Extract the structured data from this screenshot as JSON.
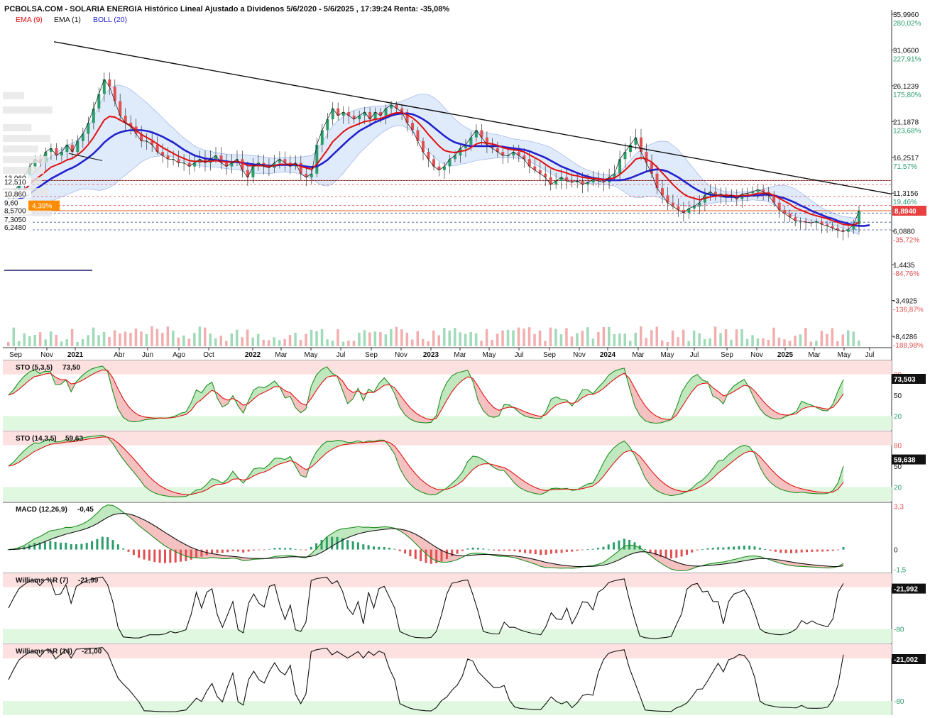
{
  "header": {
    "title": "PCBOLSA.COM - SOLARIA ENERGIA Histórico Lineal Ajustado a Dividenos 5/6/2020 - 5/6/2025 , 17:39:24 Renta: -35,08%",
    "legend": [
      {
        "label": "EMA (9)",
        "color": "#e01010"
      },
      {
        "label": "EMA (1)",
        "color": "#111111"
      },
      {
        "label": "BOLL (20)",
        "color": "#2222cc"
      }
    ]
  },
  "chart_data": [
    {
      "type": "line",
      "panel": "price",
      "ylim": [
        -8.43,
        35.996
      ],
      "right_axis": [
        {
          "value": 35.996,
          "label": "35,9960",
          "pct": "280,02%"
        },
        {
          "value": 31.06,
          "label": "31,0600",
          "pct": "227,91%"
        },
        {
          "value": 26.1239,
          "label": "26,1239",
          "pct": "175,80%"
        },
        {
          "value": 21.1878,
          "label": "21,1878",
          "pct": "123,68%"
        },
        {
          "value": 16.2517,
          "label": "16,2517",
          "pct": "71,57%"
        },
        {
          "value": 11.3156,
          "label": "11,3156",
          "pct": "19,46%"
        },
        {
          "value": 6.088,
          "label": "6,0880",
          "pct": "-35,72%"
        },
        {
          "value": 1.4435,
          "label": "1,4435",
          "pct": "-84,76%"
        },
        {
          "value": -3.4925,
          "label": "-3,4925",
          "pct": "-136,87%"
        },
        {
          "value": -8.4286,
          "label": "-8,4286",
          "pct": "-188,98%"
        }
      ],
      "last_price": {
        "value": 8.894,
        "label": "8,8940"
      },
      "left_levels": [
        {
          "value": 13.06,
          "label": "13,060"
        },
        {
          "value": 12.51,
          "label": "12,510"
        },
        {
          "value": 10.86,
          "label": "10,860"
        },
        {
          "value": 9.6,
          "label": "9,60"
        },
        {
          "value": 8.57,
          "label": "8,5700"
        },
        {
          "value": 7.305,
          "label": "7,3050"
        },
        {
          "value": 6.248,
          "label": "6,2480"
        }
      ],
      "pct_badge": "4,39%",
      "x_labels": [
        "Sep",
        "Nov",
        "2021",
        "Abr",
        "Jun",
        "Ago",
        "Oct",
        "2022",
        "Mar",
        "May",
        "Jul",
        "Sep",
        "Nov",
        "2023",
        "Mar",
        "May",
        "Jul",
        "Sep",
        "Nov",
        "2024",
        "Mar",
        "May",
        "Jul",
        "Sep",
        "Nov",
        "2025",
        "Mar",
        "May",
        "Jul"
      ],
      "price": [
        11.0,
        11.5,
        12.5,
        13.5,
        15.0,
        16.0,
        15.5,
        17.0,
        17.5,
        16.5,
        17.0,
        18.0,
        17.0,
        18.5,
        19.5,
        21.0,
        23.0,
        25.0,
        27.0,
        26.0,
        24.0,
        22.0,
        21.0,
        20.5,
        19.5,
        18.5,
        18.5,
        18.0,
        17.0,
        16.5,
        16.0,
        16.0,
        15.5,
        15.5,
        15.0,
        15.5,
        16.0,
        15.5,
        16.0,
        16.5,
        15.5,
        15.0,
        15.5,
        16.0,
        14.5,
        13.5,
        15.0,
        15.5,
        15.0,
        14.8,
        15.5,
        16.0,
        15.5,
        15.0,
        15.5,
        14.0,
        13.5,
        14.0,
        18.0,
        20.0,
        21.5,
        23.0,
        22.0,
        22.5,
        22.0,
        21.5,
        22.0,
        22.5,
        21.5,
        22.5,
        22.0,
        23.0,
        23.5,
        23.0,
        22.5,
        21.0,
        20.0,
        18.5,
        17.0,
        16.0,
        15.0,
        14.5,
        15.0,
        16.0,
        16.5,
        17.5,
        18.0,
        19.0,
        20.0,
        19.0,
        18.0,
        17.5,
        17.0,
        16.5,
        16.5,
        17.0,
        16.5,
        16.0,
        15.0,
        14.5,
        14.0,
        13.5,
        12.5,
        13.0,
        13.5,
        13.0,
        12.8,
        13.0,
        12.5,
        12.8,
        13.2,
        13.0,
        12.8,
        13.5,
        14.0,
        16.0,
        17.0,
        18.0,
        19.0,
        17.0,
        15.5,
        14.0,
        12.0,
        11.0,
        10.0,
        9.5,
        9.0,
        8.6,
        9.2,
        9.5,
        10.0,
        11.0,
        11.5,
        11.0,
        11.2,
        10.8,
        11.0,
        10.5,
        11.2,
        11.3,
        11.5,
        11.8,
        11.5,
        11.0,
        10.0,
        9.0,
        8.5,
        8.0,
        7.5,
        7.5,
        7.3,
        7.2,
        7.4,
        7.0,
        6.8,
        6.5,
        6.2,
        6.0,
        6.3,
        7.0,
        8.894
      ],
      "ema9": [
        11.0,
        11.1,
        11.4,
        11.8,
        12.5,
        13.2,
        13.7,
        14.3,
        14.9,
        15.2,
        15.5,
        15.9,
        16.1,
        16.6,
        17.2,
        18.0,
        19.0,
        20.2,
        21.4,
        21.9,
        21.8,
        21.4,
        21.0,
        20.6,
        20.0,
        19.4,
        19.0,
        18.6,
        18.1,
        17.6,
        17.2,
        16.8,
        16.4,
        16.1,
        15.8,
        15.7,
        15.7,
        15.7,
        15.7,
        15.8,
        15.7,
        15.6,
        15.6,
        15.7,
        15.5,
        15.1,
        15.1,
        15.1,
        15.1,
        15.0,
        15.1,
        15.3,
        15.3,
        15.3,
        15.3,
        15.0,
        14.8,
        14.6,
        15.3,
        16.3,
        17.3,
        18.4,
        19.1,
        19.8,
        20.3,
        20.6,
        20.9,
        21.2,
        21.3,
        21.5,
        21.6,
        21.9,
        22.2,
        22.4,
        22.4,
        22.1,
        21.7,
        21.1,
        20.3,
        19.4,
        18.6,
        17.8,
        17.2,
        17.0,
        16.9,
        17.1,
        17.2,
        17.6,
        18.1,
        18.3,
        18.2,
        18.1,
        17.9,
        17.6,
        17.4,
        17.3,
        17.2,
        17.0,
        16.6,
        16.2,
        15.8,
        15.3,
        14.8,
        14.5,
        14.3,
        14.1,
        13.8,
        13.7,
        13.5,
        13.4,
        13.3,
        13.3,
        13.2,
        13.3,
        13.4,
        13.9,
        14.5,
        15.2,
        16.0,
        16.2,
        16.0,
        15.6,
        14.9,
        14.1,
        13.3,
        12.5,
        11.8,
        11.2,
        10.8,
        10.6,
        10.4,
        10.6,
        10.8,
        10.9,
        11.0,
        11.0,
        11.0,
        10.9,
        11.0,
        11.0,
        11.1,
        11.3,
        11.3,
        11.3,
        11.0,
        10.6,
        10.2,
        9.8,
        9.3,
        9.0,
        8.7,
        8.4,
        8.2,
        8.0,
        7.8,
        7.5,
        7.3,
        7.0,
        6.9,
        6.9,
        7.3
      ],
      "boll_mid": [
        10.0,
        10.2,
        10.5,
        10.8,
        11.2,
        11.8,
        12.3,
        12.8,
        13.3,
        13.7,
        14.1,
        14.5,
        14.8,
        15.2,
        15.7,
        16.2,
        16.8,
        17.5,
        18.3,
        18.9,
        19.4,
        19.7,
        19.9,
        20.0,
        20.0,
        20.0,
        19.9,
        19.7,
        19.4,
        19.1,
        18.7,
        18.3,
        17.8,
        17.3,
        16.9,
        16.5,
        16.3,
        16.1,
        16.0,
        15.9,
        15.8,
        15.7,
        15.6,
        15.6,
        15.5,
        15.4,
        15.3,
        15.2,
        15.2,
        15.1,
        15.1,
        15.2,
        15.2,
        15.2,
        15.2,
        15.1,
        15.0,
        14.9,
        15.0,
        15.4,
        15.9,
        16.6,
        17.3,
        18.0,
        18.7,
        19.3,
        19.9,
        20.3,
        20.7,
        21.1,
        21.4,
        21.7,
        22.0,
        22.2,
        22.3,
        22.3,
        22.2,
        21.9,
        21.5,
        21.0,
        20.4,
        19.8,
        19.2,
        18.7,
        18.3,
        18.1,
        17.9,
        17.8,
        17.8,
        17.8,
        17.8,
        17.8,
        17.8,
        17.7,
        17.6,
        17.5,
        17.4,
        17.3,
        17.1,
        16.8,
        16.5,
        16.2,
        15.8,
        15.4,
        15.0,
        14.7,
        14.4,
        14.1,
        13.8,
        13.6,
        13.4,
        13.3,
        13.2,
        13.1,
        13.1,
        13.1,
        13.2,
        13.4,
        13.7,
        14.0,
        14.3,
        14.5,
        14.6,
        14.5,
        14.3,
        13.9,
        13.5,
        13.0,
        12.5,
        12.0,
        11.6,
        11.3,
        11.1,
        11.0,
        10.9,
        10.8,
        10.8,
        10.8,
        10.9,
        10.9,
        11.0,
        11.0,
        11.1,
        11.1,
        11.0,
        10.8,
        10.6,
        10.3,
        10.0,
        9.6,
        9.3,
        8.9,
        8.6,
        8.3,
        8.0,
        7.8,
        7.5,
        7.3,
        7.1,
        6.9,
        6.8,
        6.8,
        6.9
      ],
      "boll_width": [
        1.5,
        1.6,
        1.8,
        2.0,
        2.3,
        2.6,
        2.8,
        3.0,
        3.1,
        3.2,
        3.3,
        3.4,
        3.4,
        3.5,
        3.8,
        4.3,
        5.0,
        5.8,
        6.5,
        6.8,
        6.8,
        6.5,
        6.1,
        5.6,
        5.0,
        4.4,
        3.9,
        3.4,
        3.0,
        2.6,
        2.2,
        2.0,
        1.8,
        1.6,
        1.5,
        1.3,
        1.2,
        1.1,
        1.1,
        1.0,
        1.0,
        1.0,
        1.0,
        1.0,
        1.1,
        1.2,
        1.2,
        1.2,
        1.1,
        1.1,
        1.0,
        1.0,
        1.0,
        1.0,
        1.1,
        1.2,
        1.4,
        1.6,
        2.2,
        3.0,
        3.6,
        4.0,
        4.0,
        3.9,
        3.7,
        3.4,
        3.1,
        2.8,
        2.5,
        2.2,
        1.9,
        1.7,
        1.6,
        1.6,
        1.7,
        2.0,
        2.4,
        3.0,
        3.5,
        3.9,
        4.1,
        4.1,
        3.9,
        3.6,
        3.2,
        2.8,
        2.5,
        2.2,
        2.0,
        1.9,
        1.8,
        1.7,
        1.6,
        1.5,
        1.4,
        1.3,
        1.3,
        1.3,
        1.4,
        1.5,
        1.6,
        1.7,
        1.8,
        1.8,
        1.7,
        1.5,
        1.3,
        1.1,
        1.0,
        0.9,
        0.8,
        0.7,
        0.7,
        0.7,
        0.8,
        1.2,
        1.8,
        2.5,
        3.0,
        3.3,
        3.5,
        3.6,
        3.8,
        4.0,
        4.1,
        4.0,
        3.8,
        3.4,
        3.0,
        2.6,
        2.1,
        1.6,
        1.2,
        1.0,
        0.8,
        0.7,
        0.7,
        0.6,
        0.6,
        0.6,
        0.6,
        0.7,
        0.8,
        1.0,
        1.3,
        1.6,
        1.8,
        1.9,
        1.9,
        1.8,
        1.6,
        1.4,
        1.2,
        1.0,
        0.9,
        0.8,
        0.8,
        0.8,
        0.9,
        1.0,
        1.2
      ],
      "trendline": [
        {
          "x": 17,
          "y": 32.2
        },
        {
          "x": 187,
          "y": 11.2
        }
      ],
      "volume_max": 1.0,
      "volume_spike_index": 164
    },
    {
      "type": "line",
      "panel": "sto_5_3_5",
      "title": "STO (5,3,5)",
      "title_value": "73,50",
      "ylim": [
        0,
        100
      ],
      "levels": [
        80,
        50,
        20
      ],
      "last_value": "73,503"
    },
    {
      "type": "line",
      "panel": "sto_14_3_5",
      "title": "STO (14,3,5)",
      "title_value": "59,63",
      "ylim": [
        0,
        100
      ],
      "levels": [
        80,
        50,
        20
      ],
      "last_value": "59,638"
    },
    {
      "type": "line",
      "panel": "macd",
      "title": "MACD (12,26,9)",
      "title_value": "-0,45",
      "ylim": [
        -1.7,
        3.6
      ],
      "axis_labels": [
        {
          "value": 3.3,
          "label": "3,3"
        },
        {
          "value": 0,
          "label": "0"
        },
        {
          "value": -1.5,
          "label": "-1,5"
        }
      ]
    },
    {
      "type": "line",
      "panel": "williams_7",
      "title": "Williams %R (7)",
      "title_value": "-21,99",
      "ylim": [
        -100,
        0
      ],
      "levels": [
        -20,
        -80
      ],
      "last_value": "-21,992"
    },
    {
      "type": "line",
      "panel": "williams_14",
      "title": "Williams %R (14)",
      "title_value": "-21,00",
      "ylim": [
        -100,
        0
      ],
      "levels": [
        -20,
        -80
      ],
      "last_value": "-21,002"
    }
  ],
  "colors": {
    "up": "#2a9d6b",
    "down": "#e05050",
    "ema9": "#e01010",
    "boll": "#2222cc",
    "boll_fill": "#dce8fb",
    "overbought_zone": "#fde0e0",
    "oversold_zone": "#dff8df",
    "last_price_bg": "#e84040",
    "badge_bg": "#ff8c00"
  }
}
